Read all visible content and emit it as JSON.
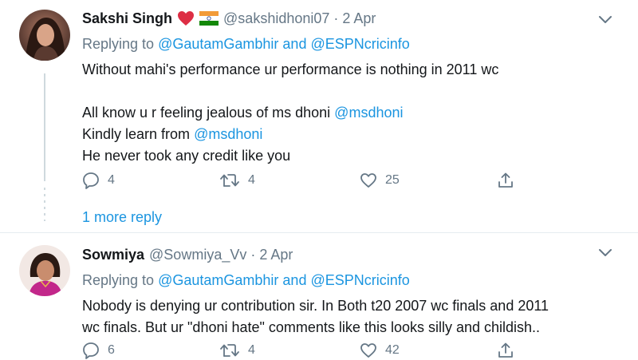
{
  "tweets": [
    {
      "name": "Sakshi Singh",
      "handle": "@sakshidhoni07",
      "separator": "·",
      "time": "2 Apr",
      "emoji": [
        "red-heart-icon",
        "india-flag-icon"
      ],
      "replying_prefix": "Replying to",
      "replying_to": [
        "@GautamGambhir",
        "@ESPNcricinfo"
      ],
      "replying_and": "and",
      "text_lines": [
        "Without mahi's performance ur performance is nothing in 2011 wc",
        "",
        "All know u r feeling jealous of ms dhoni ",
        "Kindly learn from ",
        "He never took any credit like you"
      ],
      "inline_mentions": [
        "@msdhoni",
        "@msdhoni"
      ],
      "replies": "4",
      "retweets": "4",
      "likes": "25"
    },
    {
      "name": "Sowmiya",
      "handle": "@Sowmiya_Vv",
      "separator": "·",
      "time": "2 Apr",
      "replying_prefix": "Replying to",
      "replying_to": [
        "@GautamGambhir",
        "@ESPNcricinfo"
      ],
      "replying_and": "and",
      "text_lines": [
        "Nobody is denying ur contribution sir. In Both t20 2007 wc finals and 2011",
        "wc finals. But ur \"dhoni hate\" comments like this looks silly and childish.."
      ],
      "replies": "6",
      "retweets": "4",
      "likes": "42"
    }
  ],
  "more_reply_label": "1 more reply",
  "colors": {
    "accent": "#1b95e0",
    "secondary_text": "#657786",
    "primary_text": "#14171a",
    "divider": "#e6ecf0"
  }
}
